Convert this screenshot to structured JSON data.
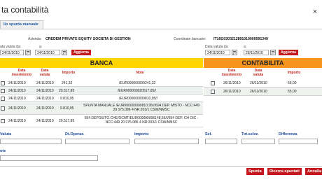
{
  "window": {
    "title": "ta contabilità",
    "close_symbol": "×"
  },
  "tab": {
    "label": "lio spunta manuale"
  },
  "header": {
    "azienda_label": "Azienda:",
    "azienda_value": "CREDEM PRIVATE EQUITY SOCIETA DI GESTION",
    "coord_label": "Coordinate bancarie:",
    "coord_value": "IT16G0303212891010000091349"
  },
  "filters_left": {
    "label_from": "ata valuta da:",
    "label_to": "a:",
    "from_value": "24/11/2010",
    "to_value": "24/11/2010",
    "update_label": "Aggiorna"
  },
  "filters_right": {
    "label_from": "Data valuta da:",
    "label_to": "a:",
    "from_value": "24/11/2010",
    "to_value": "29/11/2010",
    "update_label": "Aggiorna"
  },
  "banca": {
    "title": "BANCA",
    "columns": [
      "Data inserimento",
      "Data valuta",
      "Importo",
      "Note"
    ],
    "rows": [
      {
        "data_ins": "24/11/2010",
        "data_val": "24/11/2010",
        "importo": "241,32",
        "note": "/EUR000000000241,32"
      },
      {
        "data_ins": "24/11/2010",
        "data_val": "24/11/2010",
        "importo": "20.517,85",
        "note": "/EUR000000020517,85//"
      },
      {
        "data_ins": "24/11/2010",
        "data_val": "24/11/2010",
        "importo": "9.810,95",
        "note": "/EUR000000009810,95//"
      },
      {
        "data_ins": "24/11/2010",
        "data_val": "24/11/2010",
        "importo": "9.810,95",
        "note": "SPUNTA MANUALE /EUR000000009810,95///694 DEP. MISTO - NCC:449 20 075.086 4 NR:203/1 CSW/NMSC"
      },
      {
        "data_ins": "24/11/2010",
        "data_val": "24/11/2010",
        "importo": "20.517,85",
        "note": "694 DEPOSITO CHE/OCMT/EUR000000006148,56///694 DEP. CH OIC - NCC:449 20 075.086 4 NR:203/1 CSW/NMSC"
      }
    ]
  },
  "contabilita": {
    "title": "CONTABILITA",
    "columns": [
      "Data inserimento",
      "Data valuta",
      "Importo"
    ],
    "rows": [
      {
        "data_ins": "26/11/2010",
        "data_val": "26/11/2010",
        "importo": "55,00"
      },
      {
        "data_ins": "26/11/2010",
        "data_val": "26/11/2010",
        "importo": "55,00"
      }
    ]
  },
  "footer": {
    "labels": {
      "valuta": "Valuta",
      "dt_operaz": "Dt.Operaz.",
      "importo": "Importo",
      "sel": "Sel.",
      "tot_selez": "Tot.selez.",
      "differenza": "Differenza",
      "note": "ote"
    },
    "buttons": {
      "spunta": "Spunta",
      "ricerca": "Ricerca spuntati",
      "annulla": "Annulla"
    }
  }
}
